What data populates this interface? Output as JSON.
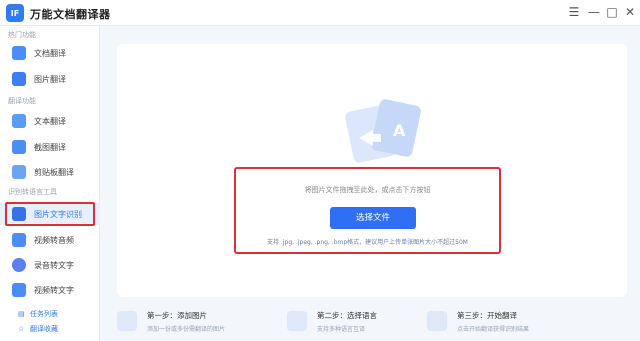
{
  "app": {
    "title": "万能文档翻译器",
    "logo_text": "IF"
  },
  "window_controls": {
    "menu": "☰",
    "minimize": "—",
    "maximize": "□",
    "close": "✕"
  },
  "sidebar": {
    "sections": [
      {
        "label": "热门功能"
      },
      {
        "label": "翻译功能"
      },
      {
        "label": "识别转语言工具"
      }
    ],
    "items": [
      {
        "label": "文档翻译",
        "icon": "document-icon",
        "color": "#4a8df8"
      },
      {
        "label": "图片翻译",
        "icon": "image-icon",
        "color": "#3d7ef2"
      },
      {
        "label": "文本翻译",
        "icon": "text-icon",
        "color": "#5a9bf7"
      },
      {
        "label": "截图翻译",
        "icon": "screenshot-icon",
        "color": "#4a8df8"
      },
      {
        "label": "剪贴板翻译",
        "icon": "clipboard-icon",
        "color": "#6aa5f5"
      },
      {
        "label": "图片文字识别",
        "icon": "ocr-icon",
        "color": "#3672e8",
        "active": true
      },
      {
        "label": "视频转音频",
        "icon": "video-audio-icon",
        "color": "#4a8df8"
      },
      {
        "label": "录音转文字",
        "icon": "recording-icon",
        "color": "#5a7ff0"
      },
      {
        "label": "视频转文字",
        "icon": "video-text-icon",
        "color": "#4a8df8"
      }
    ],
    "bottom": [
      {
        "label": "任务列表",
        "icon": "task-list-icon"
      },
      {
        "label": "翻译收藏",
        "icon": "star-icon"
      }
    ]
  },
  "main": {
    "drop_hint": "将图片文件拖拽至此处，或点击下方按钮",
    "select_button": "选择文件",
    "format_hint": "支持 .jpg, .jpeg, .png, .bmp格式，建议用户上传单张图片大小不超过50M"
  },
  "steps": [
    {
      "title": "第一步：添加图片",
      "desc": "添加一份或多份需翻译的图片"
    },
    {
      "title": "第二步：选择语言",
      "desc": "支持多种语言互译"
    },
    {
      "title": "第三步：开始翻译",
      "desc": "点击开始翻译获得识别结果"
    }
  ],
  "colors": {
    "accent": "#2f6ff5",
    "highlight_border": "#d9303a"
  }
}
